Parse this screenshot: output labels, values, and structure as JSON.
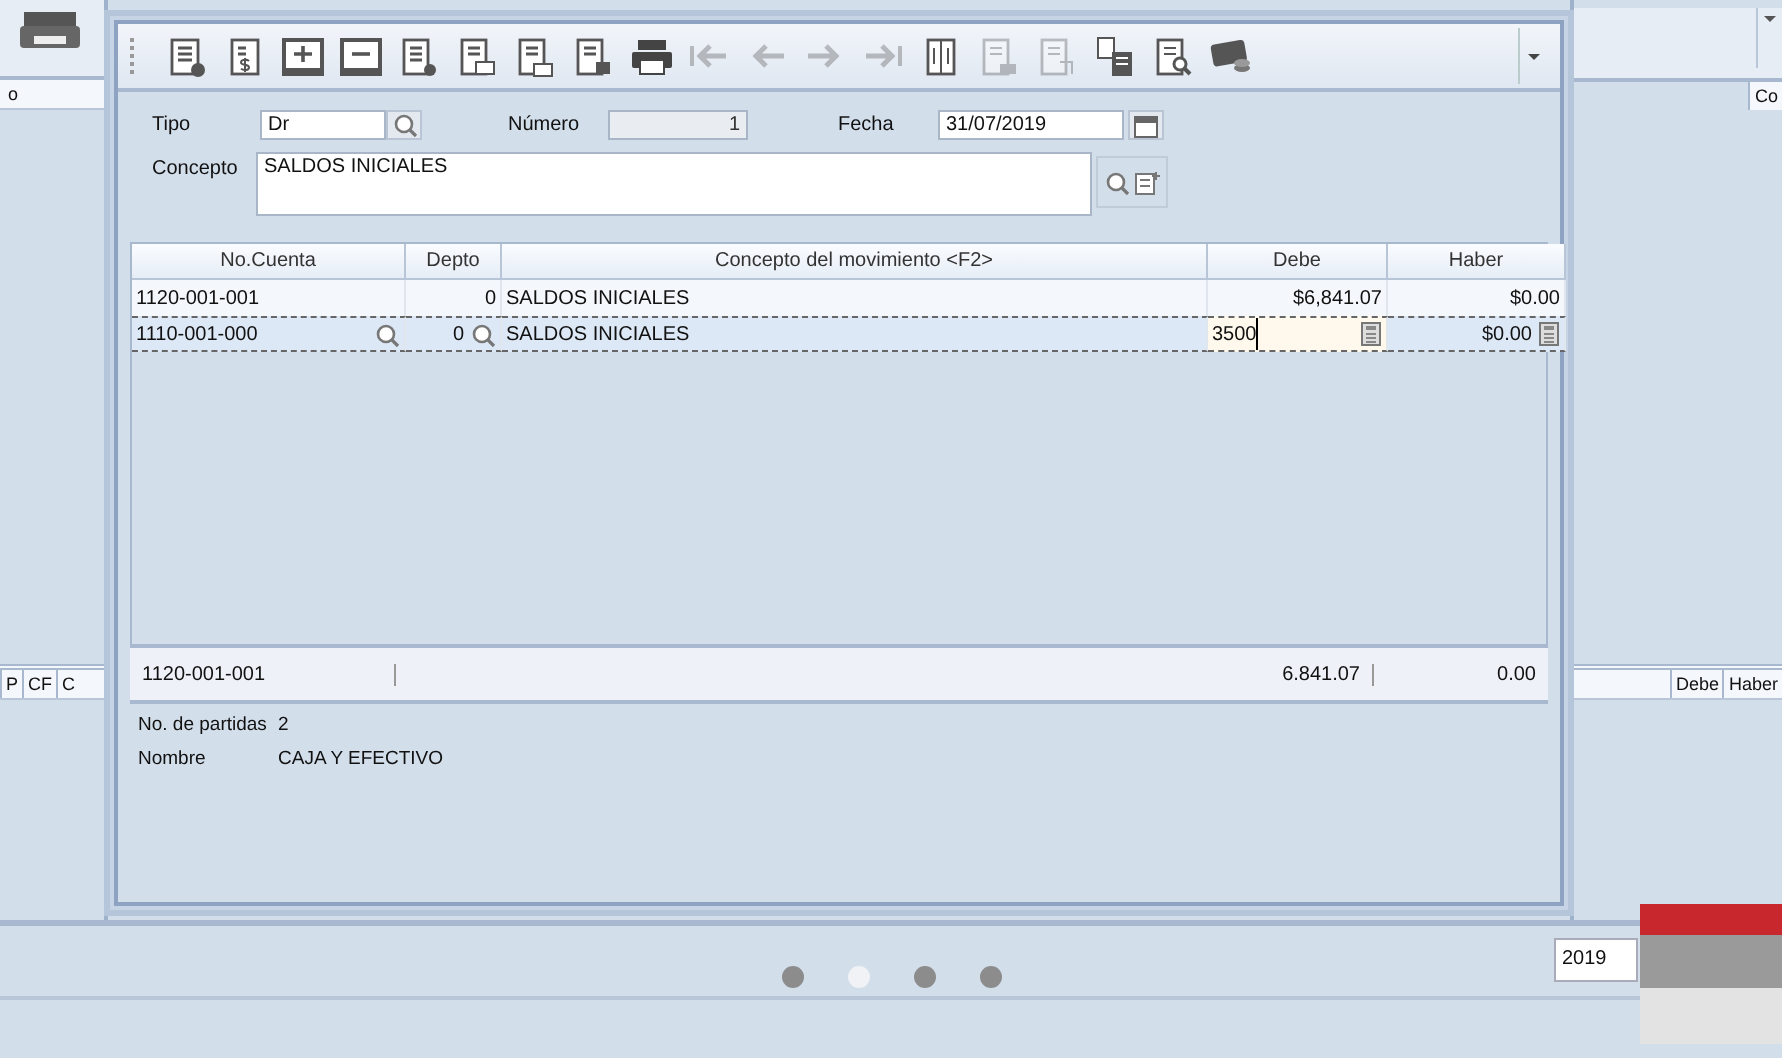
{
  "background": {
    "left_column_header": "o",
    "right_column_header": "Co",
    "lower_left_headers": [
      "P",
      "CF",
      "C"
    ],
    "lower_right_headers": [
      "Debe",
      "Haber"
    ],
    "year_field": "2019",
    "page_dots": [
      {
        "selected": false
      },
      {
        "selected": true
      },
      {
        "selected": false
      },
      {
        "selected": false
      }
    ]
  },
  "toolbar": {
    "buttons": [
      {
        "disabled": false
      },
      {
        "disabled": false
      },
      {
        "disabled": false
      },
      {
        "disabled": false
      },
      {
        "disabled": false
      },
      {
        "disabled": false
      },
      {
        "disabled": false
      },
      {
        "disabled": false
      },
      {
        "disabled": false
      },
      {
        "disabled": true
      },
      {
        "disabled": true
      },
      {
        "disabled": true
      },
      {
        "disabled": true
      },
      {
        "disabled": false
      },
      {
        "disabled": true
      },
      {
        "disabled": true
      },
      {
        "disabled": false
      },
      {
        "disabled": false
      },
      {
        "disabled": false
      }
    ]
  },
  "form": {
    "tipo": {
      "label": "Tipo",
      "value": "Dr"
    },
    "numero": {
      "label": "Número",
      "value": "1"
    },
    "fecha": {
      "label": "Fecha",
      "value": "31/07/2019"
    },
    "concepto": {
      "label": "Concepto",
      "value": "SALDOS INICIALES"
    }
  },
  "grid": {
    "columns": [
      "No.Cuenta",
      "Depto",
      "Concepto del movimiento <F2>",
      "Debe",
      "Haber"
    ],
    "rows": [
      {
        "cuenta": "1120-001-001",
        "depto": "0",
        "concepto": "SALDOS INICIALES",
        "debe": "$6,841.07",
        "haber": "$0.00",
        "selected": false
      },
      {
        "cuenta": "1110-001-000",
        "depto": "0",
        "concepto": "SALDOS INICIALES",
        "debe": "3500",
        "haber": "$0.00",
        "selected": true
      }
    ]
  },
  "totals": {
    "cuenta": "1120-001-001",
    "debe": "6.841.07",
    "haber": "0.00"
  },
  "info": [
    {
      "label": "No. de partidas",
      "value": "2"
    },
    {
      "label": "Nombre",
      "value": "CAJA Y EFECTIVO"
    }
  ]
}
